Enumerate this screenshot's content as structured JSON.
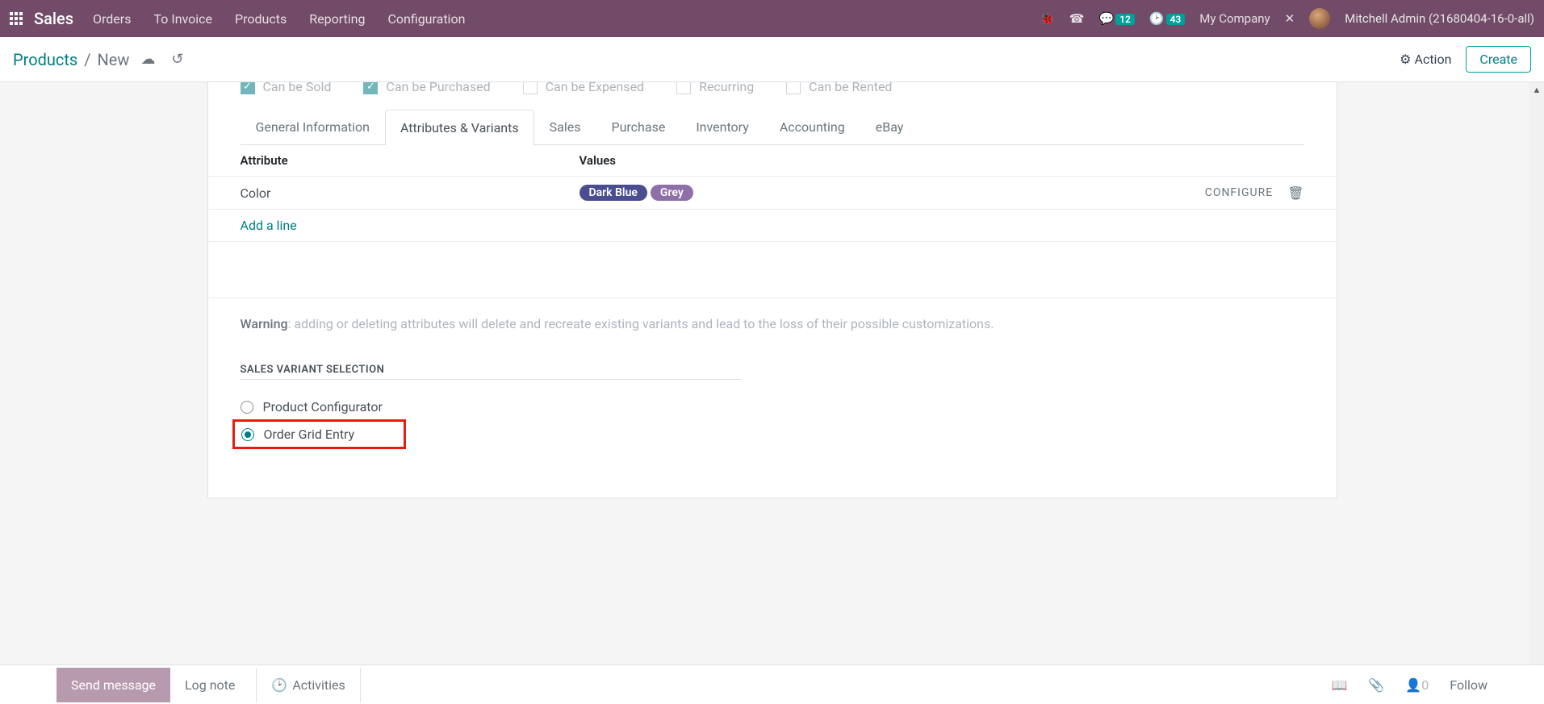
{
  "topbar": {
    "brand": "Sales",
    "nav": [
      "Orders",
      "To Invoice",
      "Products",
      "Reporting",
      "Configuration"
    ],
    "messages_badge": "12",
    "activities_badge": "43",
    "company": "My Company",
    "user": "Mitchell Admin (21680404-16-0-all)"
  },
  "subbar": {
    "breadcrumb_root": "Products",
    "breadcrumb_sep": "/",
    "breadcrumb_current": "New",
    "action_label": "Action",
    "create_label": "Create"
  },
  "checkboxes": {
    "can_be_sold": "Can be Sold",
    "can_be_purchased": "Can be Purchased",
    "can_be_expensed": "Can be Expensed",
    "recurring": "Recurring",
    "can_be_rented": "Can be Rented"
  },
  "tabs": [
    "General Information",
    "Attributes & Variants",
    "Sales",
    "Purchase",
    "Inventory",
    "Accounting",
    "eBay"
  ],
  "table": {
    "header_attr": "Attribute",
    "header_val": "Values",
    "row": {
      "attribute": "Color",
      "values": [
        {
          "label": "Dark Blue",
          "color": "#4A4D8F"
        },
        {
          "label": "Grey",
          "color": "#8E6FA8"
        }
      ],
      "configure": "CONFIGURE"
    },
    "add_line": "Add a line"
  },
  "warning": {
    "label": "Warning",
    "text": ": adding or deleting attributes will delete and recreate existing variants and lead to the loss of their possible customizations."
  },
  "section_title": "SALES VARIANT SELECTION",
  "radios": {
    "opt1": "Product Configurator",
    "opt2": "Order Grid Entry"
  },
  "footer": {
    "send": "Send message",
    "log": "Log note",
    "activities": "Activities",
    "follower_count": "0",
    "follow": "Follow"
  }
}
